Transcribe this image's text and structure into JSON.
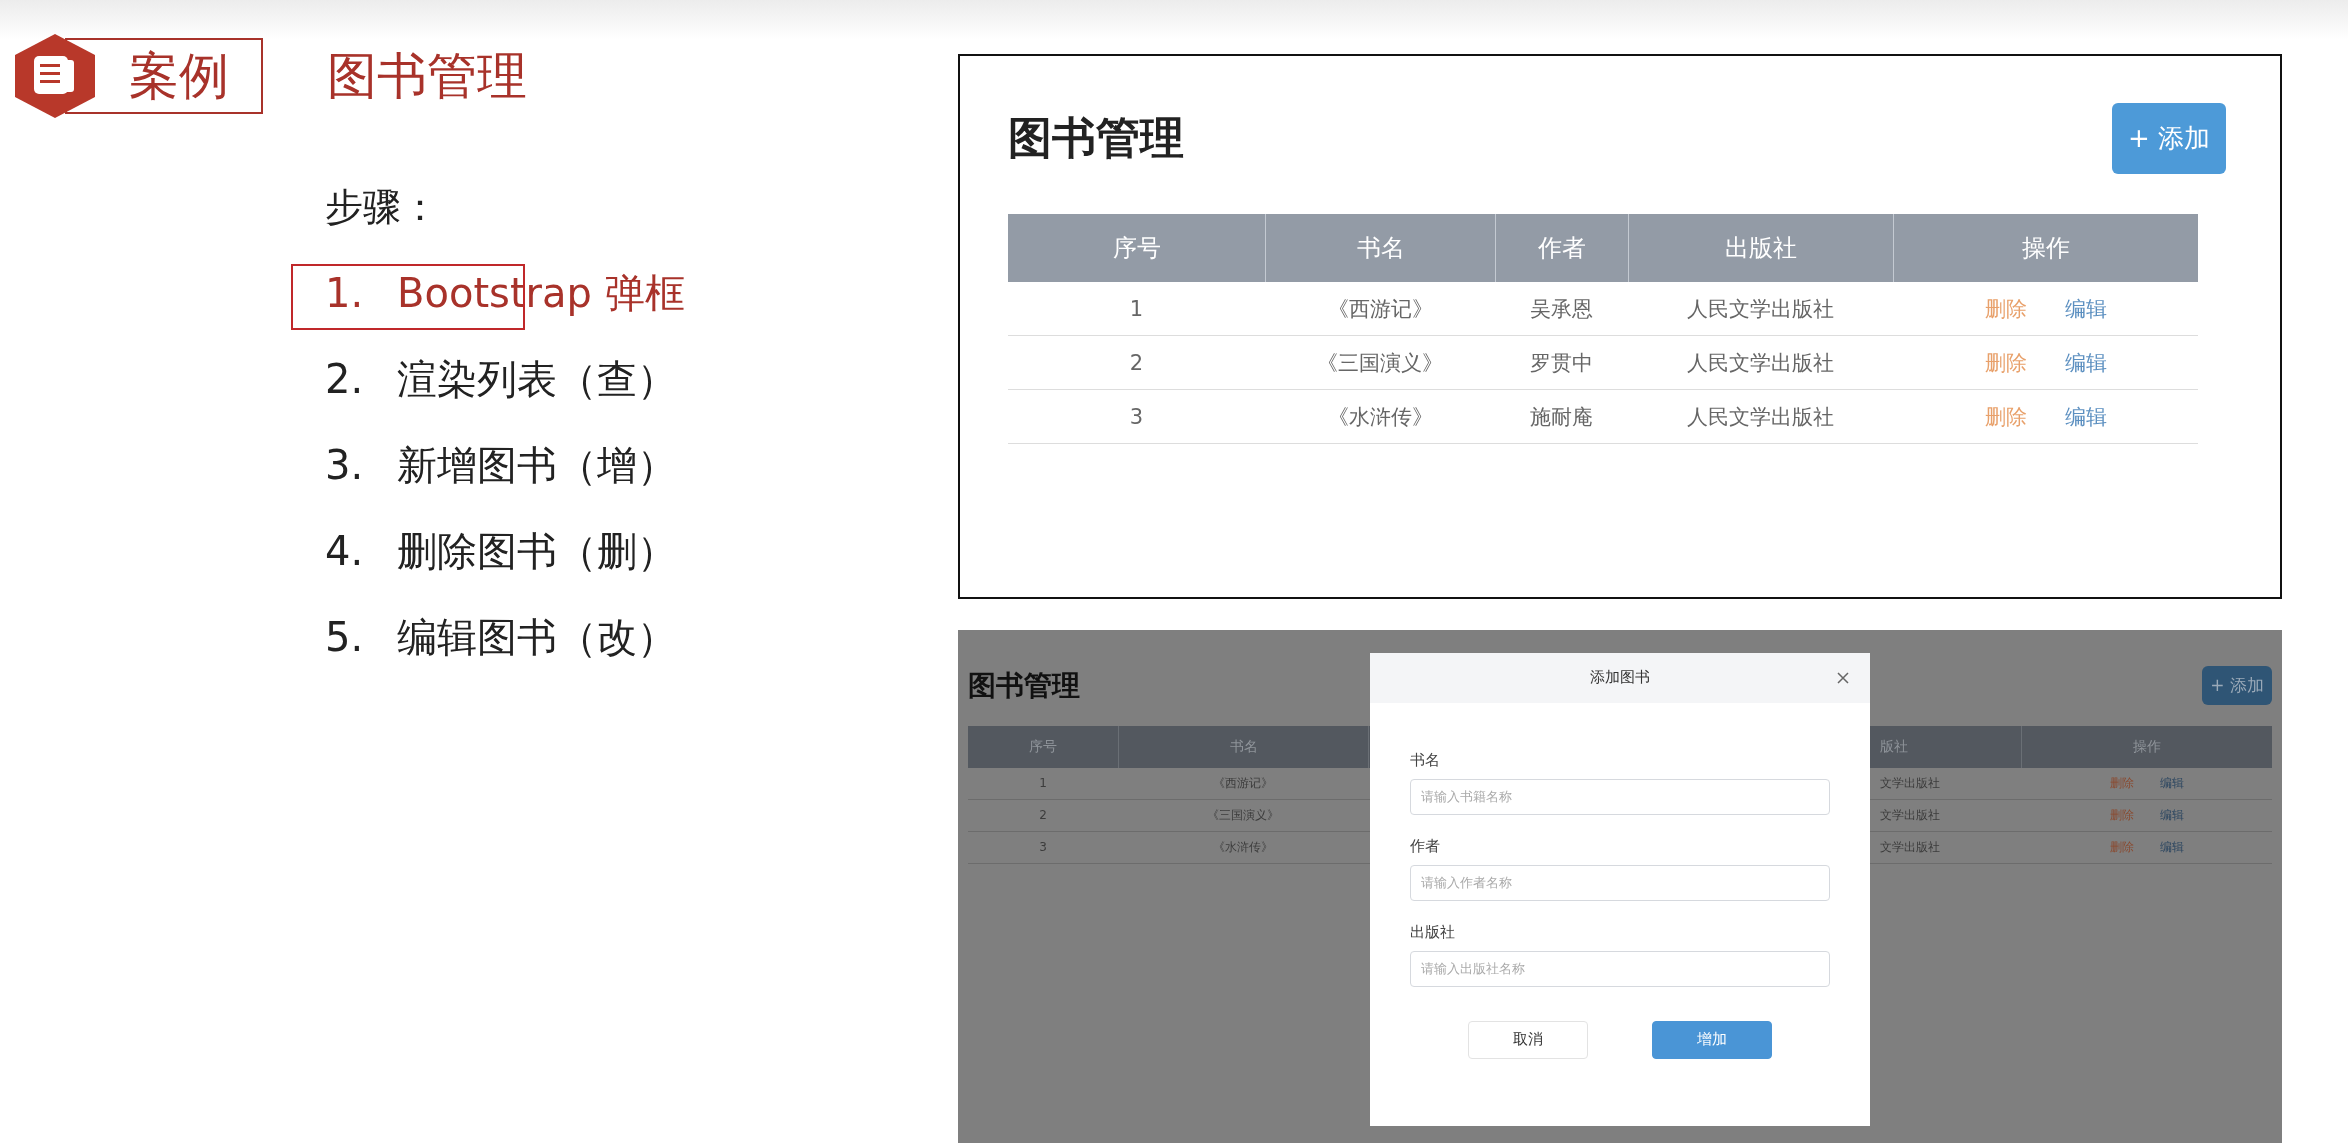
{
  "badge": {
    "label": "案例"
  },
  "title": "图书管理",
  "steps_heading": "步骤：",
  "steps": [
    {
      "number": "1.",
      "text": "Bootstrap 弹框",
      "selected": true
    },
    {
      "number": "2.",
      "text": "渲染列表（查）",
      "selected": false
    },
    {
      "number": "3.",
      "text": "新增图书（增）",
      "selected": false
    },
    {
      "number": "4.",
      "text": "删除图书（删）",
      "selected": false
    },
    {
      "number": "5.",
      "text": "编辑图书（改）",
      "selected": false
    }
  ],
  "book_page": {
    "title": "图书管理",
    "add_button": "+ 添加",
    "columns": [
      "序号",
      "书名",
      "作者",
      "出版社",
      "操作"
    ],
    "rows": [
      {
        "cells": [
          "1",
          "《西游记》",
          "吴承恩",
          "人民文学出版社"
        ],
        "actions": [
          "删除",
          "编辑"
        ]
      },
      {
        "cells": [
          "2",
          "《三国演义》",
          "罗贯中",
          "人民文学出版社"
        ],
        "actions": [
          "删除",
          "编辑"
        ]
      },
      {
        "cells": [
          "3",
          "《水浒传》",
          "施耐庵",
          "人民文学出版社"
        ],
        "actions": [
          "删除",
          "编辑"
        ]
      }
    ]
  },
  "dialog_screen": {
    "page_title": "图书管理",
    "add_button": "+ 添加",
    "columns": [
      "序号",
      "书名",
      "版社",
      "操作"
    ],
    "rows": [
      {
        "cells": [
          "1",
          "《西游记》",
          "文学出版社"
        ],
        "actions": [
          "删除",
          "编辑"
        ]
      },
      {
        "cells": [
          "2",
          "《三国演义》",
          "文学出版社"
        ],
        "actions": [
          "删除",
          "编辑"
        ]
      },
      {
        "cells": [
          "3",
          "《水浒传》",
          "文学出版社"
        ],
        "actions": [
          "删除",
          "编辑"
        ]
      }
    ],
    "dialog": {
      "title": "添加图书",
      "fields": [
        {
          "label": "书名",
          "placeholder": "请输入书籍名称"
        },
        {
          "label": "作者",
          "placeholder": "请输入作者名称"
        },
        {
          "label": "出版社",
          "placeholder": "请输入出版社名称"
        }
      ],
      "buttons": [
        {
          "label": "取消",
          "kind": "secondary"
        },
        {
          "label": "增加",
          "kind": "primary"
        }
      ]
    }
  }
}
